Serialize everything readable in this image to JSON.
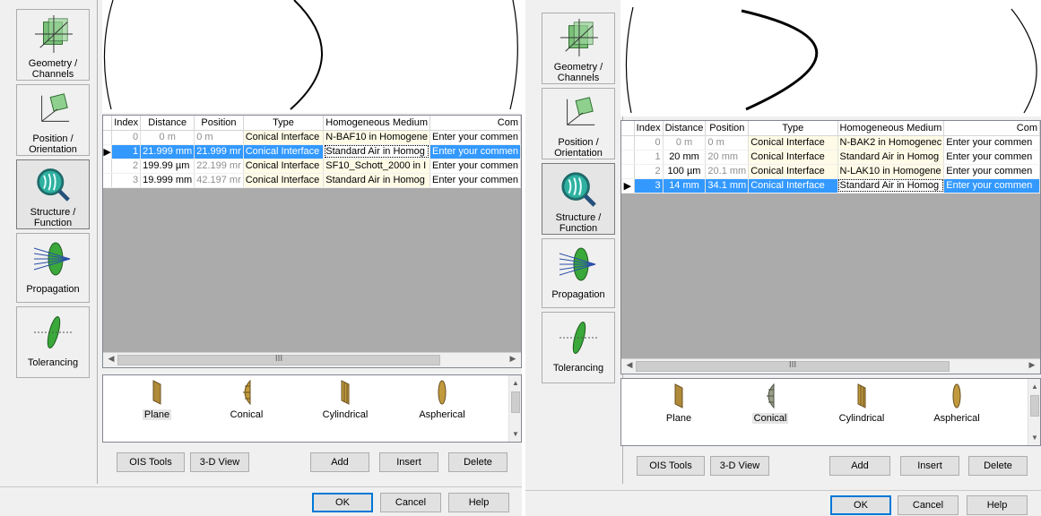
{
  "left": {
    "sidebar": [
      {
        "label": "Geometry /\nChannels",
        "icon": "geometry-channels-icon"
      },
      {
        "label": "Position /\nOrientation",
        "icon": "position-orientation-icon"
      },
      {
        "label": "Structure /\nFunction",
        "icon": "structure-function-icon"
      },
      {
        "label": "Propagation",
        "icon": "propagation-icon"
      },
      {
        "label": "Tolerancing",
        "icon": "tolerancing-icon"
      }
    ],
    "columns": [
      "Index",
      "Distance",
      "Position",
      "Type",
      "Homogeneous Medium",
      "Com"
    ],
    "rows": [
      {
        "index": "0",
        "distance": "0 m",
        "position": "0 m",
        "type": "Conical Interface",
        "medium": "N-BAF10 in Homogene",
        "comment": "Enter your commen"
      },
      {
        "index": "1",
        "distance": "21.999 mm",
        "position": "21.999 mr",
        "type": "Conical Interface",
        "medium": "Standard Air in Homog",
        "comment": "Enter your commen"
      },
      {
        "index": "2",
        "distance": "199.99 µm",
        "position": "22.199 mr",
        "type": "Conical Interface",
        "medium": "SF10_Schott_2000 in I",
        "comment": "Enter your commen"
      },
      {
        "index": "3",
        "distance": "19.999 mm",
        "position": "42.197 mr",
        "type": "Conical Interface",
        "medium": "Standard Air in Homog",
        "comment": "Enter your commen"
      }
    ],
    "scroll_thumb": "III",
    "palette": [
      "Plane",
      "Conical",
      "Cylindrical",
      "Aspherical"
    ],
    "buttons": {
      "ois_tools": "OIS Tools",
      "view3d": "3-D View",
      "add": "Add",
      "insert": "Insert",
      "delete": "Delete"
    },
    "dialog": {
      "ok": "OK",
      "cancel": "Cancel",
      "help": "Help"
    }
  },
  "right": {
    "sidebar": [
      {
        "label": "Geometry /\nChannels",
        "icon": "geometry-channels-icon"
      },
      {
        "label": "Position /\nOrientation",
        "icon": "position-orientation-icon"
      },
      {
        "label": "Structure /\nFunction",
        "icon": "structure-function-icon"
      },
      {
        "label": "Propagation",
        "icon": "propagation-icon"
      },
      {
        "label": "Tolerancing",
        "icon": "tolerancing-icon"
      }
    ],
    "columns": [
      "Index",
      "Distance",
      "Position",
      "Type",
      "Homogeneous Medium",
      "Com"
    ],
    "rows": [
      {
        "index": "0",
        "distance": "0 m",
        "position": "0 m",
        "type": "Conical Interface",
        "medium": "N-BAK2 in Homogenec",
        "comment": "Enter your commen"
      },
      {
        "index": "1",
        "distance": "20 mm",
        "position": "20 mm",
        "type": "Conical Interface",
        "medium": "Standard Air in Homog",
        "comment": "Enter your commen"
      },
      {
        "index": "2",
        "distance": "100 µm",
        "position": "20.1 mm",
        "type": "Conical Interface",
        "medium": "N-LAK10 in Homogene",
        "comment": "Enter your commen"
      },
      {
        "index": "3",
        "distance": "14 mm",
        "position": "34.1 mm",
        "type": "Conical Interface",
        "medium": "Standard Air in Homog",
        "comment": "Enter your commen"
      }
    ],
    "scroll_thumb": "III",
    "palette": [
      "Plane",
      "Conical",
      "Cylindrical",
      "Aspherical"
    ],
    "buttons": {
      "ois_tools": "OIS Tools",
      "view3d": "3-D View",
      "add": "Add",
      "insert": "Insert",
      "delete": "Delete"
    },
    "dialog": {
      "ok": "OK",
      "cancel": "Cancel",
      "help": "Help"
    }
  },
  "colors": {
    "selection": "#3399ff",
    "panel": "#f0f0f0",
    "grid_empty": "#ababab"
  }
}
